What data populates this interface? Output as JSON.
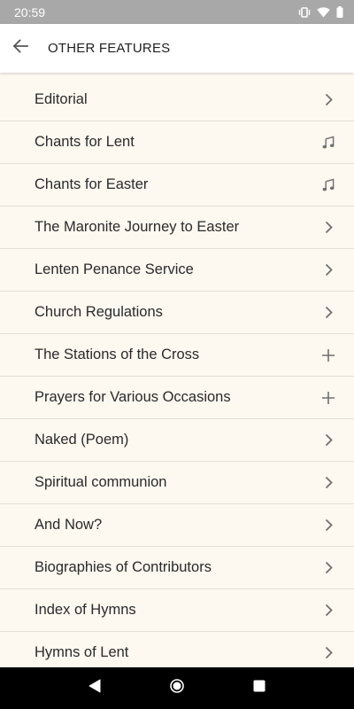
{
  "status_bar": {
    "time": "20:59",
    "icons": [
      "vibrate-icon",
      "wifi-icon",
      "battery-icon"
    ]
  },
  "app_bar": {
    "back_icon": "arrow-back-icon",
    "title": "OTHER FEATURES"
  },
  "colors": {
    "status_bar_bg": "#a8a8a8",
    "list_bg": "#fdf8f0",
    "divider": "#e3ded6",
    "icon": "#707070"
  },
  "items": [
    {
      "label": "Editorial",
      "icon": "chevron-right-icon"
    },
    {
      "label": "Chants for Lent",
      "icon": "music-note-icon"
    },
    {
      "label": "Chants for Easter",
      "icon": "music-note-icon"
    },
    {
      "label": "The Maronite Journey to Easter",
      "icon": "chevron-right-icon"
    },
    {
      "label": "Lenten Penance Service",
      "icon": "chevron-right-icon"
    },
    {
      "label": "Church Regulations",
      "icon": "chevron-right-icon"
    },
    {
      "label": "The Stations of the Cross",
      "icon": "plus-icon"
    },
    {
      "label": "Prayers for Various Occasions",
      "icon": "plus-icon"
    },
    {
      "label": "Naked (Poem)",
      "icon": "chevron-right-icon"
    },
    {
      "label": "Spiritual communion",
      "icon": "chevron-right-icon"
    },
    {
      "label": "And Now?",
      "icon": "chevron-right-icon"
    },
    {
      "label": "Biographies of Contributors",
      "icon": "chevron-right-icon"
    },
    {
      "label": "Index of Hymns",
      "icon": "chevron-right-icon"
    },
    {
      "label": "Hymns of Lent",
      "icon": "chevron-right-icon"
    }
  ],
  "nav_bar": {
    "buttons": [
      "back-triangle-icon",
      "home-circle-icon",
      "recents-square-icon"
    ]
  }
}
